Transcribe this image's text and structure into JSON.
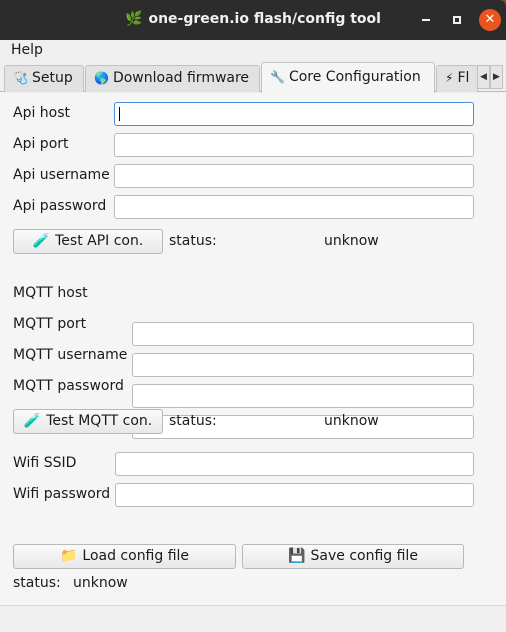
{
  "window": {
    "title": "one-green.io flash/config tool"
  },
  "menu": {
    "help": "Help"
  },
  "tabs": [
    {
      "label": "Setup",
      "icon": "stethoscope-icon"
    },
    {
      "label": "Download firmware",
      "icon": "globe-icon"
    },
    {
      "label": "Core Configuration",
      "icon": "wrench-icon",
      "active": true
    },
    {
      "label": "Fl",
      "icon": "lightning-icon"
    }
  ],
  "api": {
    "host_label": "Api host",
    "port_label": "Api port",
    "username_label": "Api username",
    "password_label": "Api password",
    "host_value": "",
    "port_value": "",
    "username_value": "",
    "password_value": "",
    "test_button": "Test API con.",
    "status_label": "status:",
    "status_value": "unknow"
  },
  "mqtt": {
    "host_label": "MQTT host",
    "port_label": "MQTT port",
    "username_label": "MQTT username",
    "password_label": "MQTT password",
    "host_value": "",
    "port_value": "",
    "username_value": "",
    "password_value": "",
    "test_button": "Test MQTT con.",
    "status_label": "status:",
    "status_value": "unknow"
  },
  "wifi": {
    "ssid_label": "Wifi SSID",
    "password_label": "Wifi password",
    "ssid_value": "",
    "password_value": ""
  },
  "config": {
    "load_button": "Load config file",
    "save_button": "Save config file",
    "status_label": "status:",
    "status_value": "unknow"
  },
  "colors": {
    "close_button": "#e95420",
    "titlebar": "#2c2c2c",
    "focus_border": "#4a90d9",
    "leaf": "#7cc35a"
  }
}
